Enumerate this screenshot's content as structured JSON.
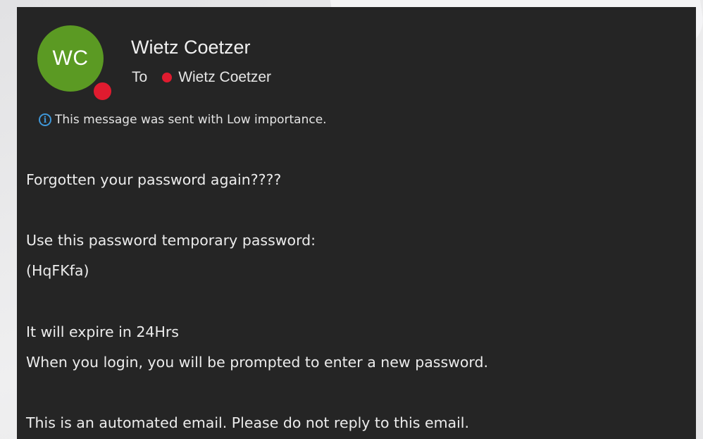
{
  "message": {
    "sender": {
      "initials": "WC",
      "name": "Wietz Coetzer",
      "avatar_color": "#5b9a23",
      "presence_color": "#e01b2f"
    },
    "to_label": "To",
    "recipient": "Wietz Coetzer",
    "importance_notice": "This message was sent with Low importance.",
    "body": [
      "Forgotten your password again????",
      "Use this password temporary password:",
      "(HqFKfa)",
      "It will expire in 24Hrs",
      "When you login, you will be prompted to enter a new password.",
      "This is an automated email. Please do not reply to this email."
    ]
  },
  "icons": {
    "importance": "info-icon",
    "presence": "presence-dot-icon"
  },
  "colors": {
    "background": "#252525",
    "text": "#ececec",
    "info_accent": "#3f97d8"
  }
}
